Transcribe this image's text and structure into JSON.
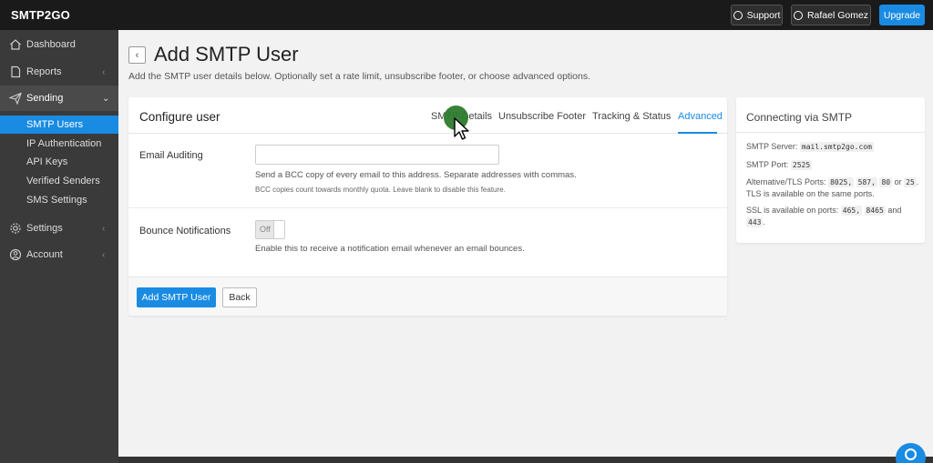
{
  "brand": {
    "logo_text": "SMTP2GO"
  },
  "topbar": {
    "support_label": "Support",
    "user_label": "Rafael Gomez",
    "upgrade_label": "Upgrade"
  },
  "sidebar": {
    "items": [
      {
        "label": "Dashboard",
        "icon": "home-icon"
      },
      {
        "label": "Reports",
        "icon": "document-icon"
      },
      {
        "label": "Sending",
        "icon": "paper-plane-icon"
      },
      {
        "label": "Settings",
        "icon": "gear-icon"
      },
      {
        "label": "Account",
        "icon": "user-icon"
      }
    ],
    "sending_sub": [
      "SMTP Users",
      "IP Authentication",
      "API Keys",
      "Verified Senders",
      "SMS Settings"
    ]
  },
  "page": {
    "title": "Add SMTP User",
    "subtitle": "Add the SMTP user details below. Optionally set a rate limit, unsubscribe footer, or choose advanced options."
  },
  "card": {
    "title": "Configure user",
    "tabs": [
      "SMTP Details",
      "Unsubscribe Footer",
      "Tracking & Status",
      "Advanced"
    ],
    "active_tab": "Advanced",
    "email_auditing": {
      "label": "Email Auditing",
      "value": "",
      "help": "Send a BCC copy of every email to this address. Separate addresses with commas.",
      "help_small": "BCC copies count towards monthly quota. Leave blank to disable this feature."
    },
    "bounce": {
      "label": "Bounce Notifications",
      "toggle_text": "Off",
      "help": "Enable this to receive a notification email whenever an email bounces."
    },
    "buttons": {
      "primary": "Add SMTP User",
      "secondary": "Back"
    }
  },
  "side_panel": {
    "title": "Connecting via SMTP",
    "server_label": "SMTP Server:",
    "server_value": "mail.smtp2go.com",
    "port_label": "SMTP Port:",
    "port_value": "2525",
    "alt_label": "Alternative/TLS Ports:",
    "alt_ports": [
      "8025,",
      "587,",
      "80"
    ],
    "alt_or": "or",
    "alt_last": "25",
    "alt_suffix": ".",
    "tls_note": "TLS is available on the same ports.",
    "ssl_label": "SSL is available on ports:",
    "ssl_ports": [
      "465,",
      "8465"
    ],
    "ssl_and": "and",
    "ssl_last": "443",
    "ssl_suffix": "."
  },
  "colors": {
    "accent": "#1a8be2",
    "sidebar": "#3a3a3a",
    "topbar": "#1a1a1a",
    "cursor_dot": "#2d7a2d"
  }
}
